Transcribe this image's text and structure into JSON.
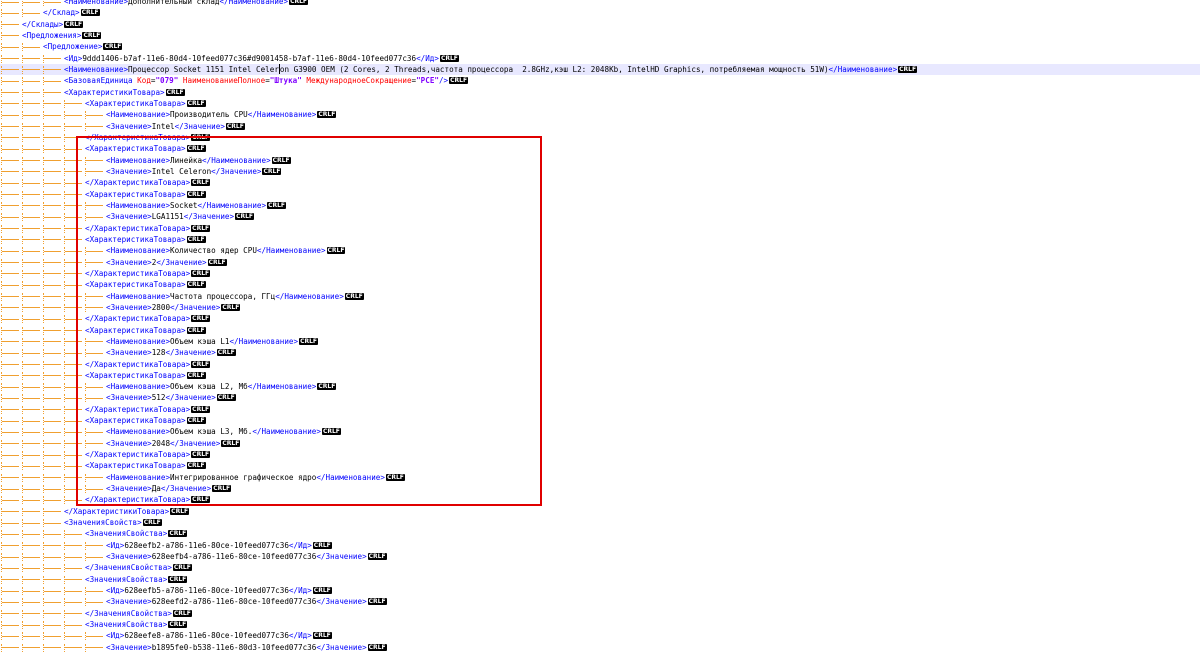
{
  "editor": {
    "lines": [
      {
        "i": 3,
        "k": "elem",
        "tag": "Наименование",
        "text": "Дополнительный склад"
      },
      {
        "i": 2,
        "k": "close",
        "tag": "Склад"
      },
      {
        "i": 1,
        "k": "close",
        "tag": "Склады"
      },
      {
        "i": 1,
        "k": "open",
        "tag": "Предложения"
      },
      {
        "i": 2,
        "k": "open",
        "tag": "Предложение"
      },
      {
        "i": 3,
        "k": "elem",
        "tag": "Ид",
        "text": "9ddd1406-b7af-11e6-80d4-10feed077c36#d9001458-b7af-11e6-80d4-10feed077c36"
      },
      {
        "i": 3,
        "k": "elem",
        "tag": "Наименование",
        "text": "Процессор Socket 1151 Intel Celeron G3900 OEM (2 Cores, 2 Threads,частота процессора  2.8GHz,кэш L2: 2048Kb, IntelHD Graphics, потребляемая мощность 51W)",
        "current": true
      },
      {
        "i": 3,
        "k": "self",
        "tag": "БазоваяЕдиница",
        "attrs": [
          [
            "Код",
            "\"079\""
          ],
          [
            "НаименованиеПолное",
            "\"Штука\""
          ],
          [
            "МеждународноеСокращение",
            "\"PCE\""
          ]
        ]
      },
      {
        "i": 3,
        "k": "open",
        "tag": "ХарактеристикиТовара"
      },
      {
        "i": 4,
        "k": "open",
        "tag": "ХарактеристикаТовара"
      },
      {
        "i": 5,
        "k": "elem",
        "tag": "Наименование",
        "text": "Производитель CPU"
      },
      {
        "i": 5,
        "k": "elem",
        "tag": "Значение",
        "text": "Intel"
      },
      {
        "i": 4,
        "k": "close",
        "tag": "ХарактеристикаТовара"
      },
      {
        "i": 4,
        "k": "open",
        "tag": "ХарактеристикаТовара"
      },
      {
        "i": 5,
        "k": "elem",
        "tag": "Наименование",
        "text": "Линейка"
      },
      {
        "i": 5,
        "k": "elem",
        "tag": "Значение",
        "text": "Intel Celeron"
      },
      {
        "i": 4,
        "k": "close",
        "tag": "ХарактеристикаТовара"
      },
      {
        "i": 4,
        "k": "open",
        "tag": "ХарактеристикаТовара"
      },
      {
        "i": 5,
        "k": "elem",
        "tag": "Наименование",
        "text": "Socket"
      },
      {
        "i": 5,
        "k": "elem",
        "tag": "Значение",
        "text": "LGA1151"
      },
      {
        "i": 4,
        "k": "close",
        "tag": "ХарактеристикаТовара"
      },
      {
        "i": 4,
        "k": "open",
        "tag": "ХарактеристикаТовара"
      },
      {
        "i": 5,
        "k": "elem",
        "tag": "Наименование",
        "text": "Количество ядер CPU"
      },
      {
        "i": 5,
        "k": "elem",
        "tag": "Значение",
        "text": "2"
      },
      {
        "i": 4,
        "k": "close",
        "tag": "ХарактеристикаТовара"
      },
      {
        "i": 4,
        "k": "open",
        "tag": "ХарактеристикаТовара"
      },
      {
        "i": 5,
        "k": "elem",
        "tag": "Наименование",
        "text": "Частота процессора, ГГц"
      },
      {
        "i": 5,
        "k": "elem",
        "tag": "Значение",
        "text": "2800"
      },
      {
        "i": 4,
        "k": "close",
        "tag": "ХарактеристикаТовара"
      },
      {
        "i": 4,
        "k": "open",
        "tag": "ХарактеристикаТовара"
      },
      {
        "i": 5,
        "k": "elem",
        "tag": "Наименование",
        "text": "Объем кэша L1"
      },
      {
        "i": 5,
        "k": "elem",
        "tag": "Значение",
        "text": "128"
      },
      {
        "i": 4,
        "k": "close",
        "tag": "ХарактеристикаТовара"
      },
      {
        "i": 4,
        "k": "open",
        "tag": "ХарактеристикаТовара"
      },
      {
        "i": 5,
        "k": "elem",
        "tag": "Наименование",
        "text": "Объем кэша L2, Мб"
      },
      {
        "i": 5,
        "k": "elem",
        "tag": "Значение",
        "text": "512"
      },
      {
        "i": 4,
        "k": "close",
        "tag": "ХарактеристикаТовара"
      },
      {
        "i": 4,
        "k": "open",
        "tag": "ХарактеристикаТовара"
      },
      {
        "i": 5,
        "k": "elem",
        "tag": "Наименование",
        "text": "Объем кэша L3, Мб."
      },
      {
        "i": 5,
        "k": "elem",
        "tag": "Значение",
        "text": "2048"
      },
      {
        "i": 4,
        "k": "close",
        "tag": "ХарактеристикаТовара"
      },
      {
        "i": 4,
        "k": "open",
        "tag": "ХарактеристикаТовара"
      },
      {
        "i": 5,
        "k": "elem",
        "tag": "Наименование",
        "text": "Интегрированное графическое ядро"
      },
      {
        "i": 5,
        "k": "elem",
        "tag": "Значение",
        "text": "Да"
      },
      {
        "i": 4,
        "k": "close",
        "tag": "ХарактеристикаТовара"
      },
      {
        "i": 3,
        "k": "close",
        "tag": "ХарактеристикиТовара"
      },
      {
        "i": 3,
        "k": "open",
        "tag": "ЗначенияСвойств"
      },
      {
        "i": 4,
        "k": "open",
        "tag": "ЗначенияСвойства"
      },
      {
        "i": 5,
        "k": "elem",
        "tag": "Ид",
        "text": "628eefb2-a786-11e6-80ce-10feed077c36"
      },
      {
        "i": 5,
        "k": "elem",
        "tag": "Значение",
        "text": "628eefb4-a786-11e6-80ce-10feed077c36"
      },
      {
        "i": 4,
        "k": "close",
        "tag": "ЗначенияСвойства"
      },
      {
        "i": 4,
        "k": "open",
        "tag": "ЗначенияСвойства"
      },
      {
        "i": 5,
        "k": "elem",
        "tag": "Ид",
        "text": "628eefb5-a786-11e6-80ce-10feed077c36"
      },
      {
        "i": 5,
        "k": "elem",
        "tag": "Значение",
        "text": "628eefd2-a786-11e6-80ce-10feed077c36"
      },
      {
        "i": 4,
        "k": "close",
        "tag": "ЗначенияСвойства"
      },
      {
        "i": 4,
        "k": "open",
        "tag": "ЗначенияСвойства"
      },
      {
        "i": 5,
        "k": "elem",
        "tag": "Ид",
        "text": "628eefe8-a786-11e6-80ce-10feed077c36"
      },
      {
        "i": 5,
        "k": "elem",
        "tag": "Значение",
        "text": "b1895fe0-b538-11e6-80d3-10feed077c36"
      }
    ],
    "eol_marker": "CRLF"
  },
  "colors": {
    "tag": "#0000ff",
    "attribute": "#ff0000",
    "attribute_value": "#8000ff",
    "text": "#000000",
    "indent_guide": "#f0a030",
    "current_line": "#e8e8ff",
    "highlight_box": "#e00000"
  }
}
